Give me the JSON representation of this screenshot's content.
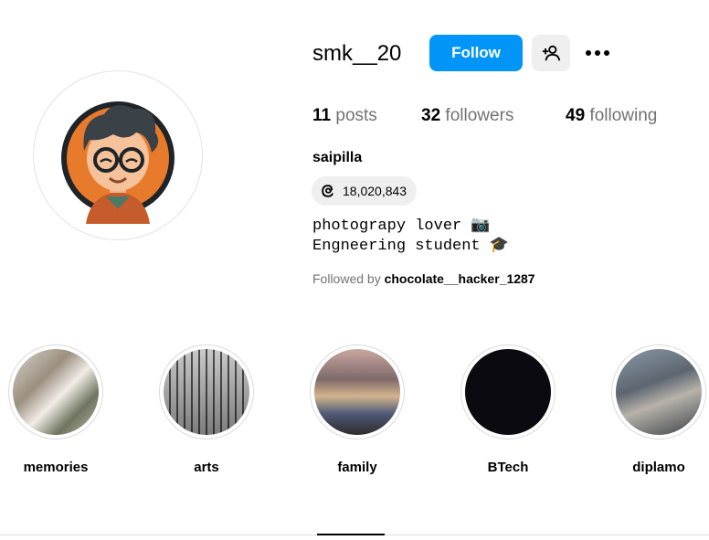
{
  "profile": {
    "username": "smk__20",
    "follow_label": "Follow",
    "more_label": "•••",
    "full_name": "saipilla",
    "threads_count": "18,020,843",
    "bio_lines": [
      "photograpy lover 📷",
      "Engneering student 🎓"
    ],
    "followed_by_prefix": "Followed by ",
    "followed_by_user": "chocolate__hacker_1287"
  },
  "stats": {
    "posts": {
      "count": "11",
      "label": "posts"
    },
    "followers": {
      "count": "32",
      "label": "followers"
    },
    "following": {
      "count": "49",
      "label": "following"
    }
  },
  "highlights": [
    {
      "label": "memories"
    },
    {
      "label": "arts"
    },
    {
      "label": "family"
    },
    {
      "label": "BTech"
    },
    {
      "label": "diplamo"
    }
  ],
  "colors": {
    "accent": "#0095f6",
    "muted_text": "#737373",
    "button_bg": "#efefef",
    "border": "#dbdbdb"
  }
}
